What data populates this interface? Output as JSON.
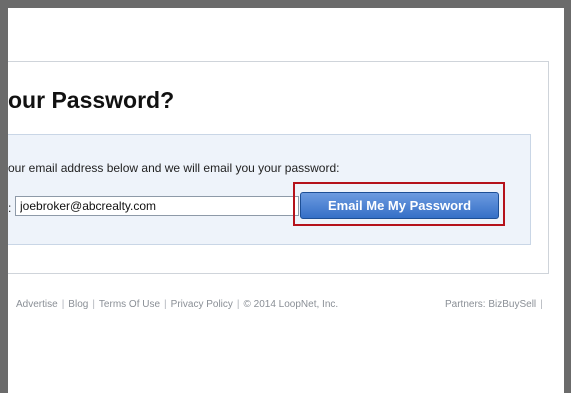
{
  "page": {
    "title": "our Password?",
    "instructions": "our email address below and we will email you your password:",
    "field_label_fragment": ":",
    "email_value": "joebroker@abcrealty.com",
    "submit_label": "Email Me My Password"
  },
  "footer": {
    "links": [
      "Advertise",
      "Blog",
      "Terms Of Use",
      "Privacy Policy"
    ],
    "copyright": "© 2014 LoopNet, Inc.",
    "partners_label": "Partners:",
    "partners": [
      "BizBuySell"
    ]
  },
  "colors": {
    "accent_button": "#356fc7",
    "highlight_border": "#b5121b",
    "panel_background": "#eef3fa"
  }
}
